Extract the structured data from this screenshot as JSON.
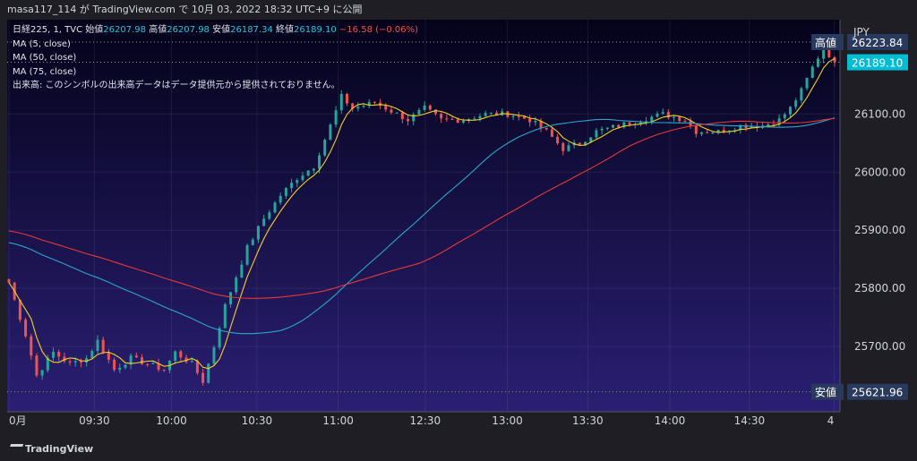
{
  "header": {
    "text": "masa117_114 が TradingView.com で 10月 03, 2022 18:32 UTC+9 に公開"
  },
  "legend": {
    "symbol": "日経225, 1, TVC",
    "open_label": "始値",
    "open": "26207.98",
    "high_label": "高値",
    "high": "26207.98",
    "low_label": "安値",
    "low": "26187.34",
    "close_label": "終値",
    "close": "26189.10",
    "change": "−16.58 (−0.06%)",
    "ma1": "MA (5, close)",
    "ma2": "MA (50, close)",
    "ma3": "MA (75, close)",
    "volume_note": "出来高: このシンボルの出来高データはデータ提供元から提供されておりません。"
  },
  "axis": {
    "currency": "JPY",
    "high_tag": "高値",
    "high_value": "26223.84",
    "last_value": "26189.10",
    "low_tag": "安値",
    "low_value": "25621.96"
  },
  "footer": {
    "brand": "TradingView"
  },
  "colors": {
    "bg_top": "#04031a",
    "bg_bottom": "#2a1f73",
    "up": "#26a69a",
    "down": "#ef5350",
    "ma5": "#f5d020",
    "ma50": "#2aa7c9",
    "ma75": "#e53935",
    "last_bg": "#00bcd4",
    "tag_bg": "#2a3a5e"
  },
  "chart_data": {
    "type": "candlestick",
    "ylim": [
      25600,
      26250
    ],
    "y_ticks": [
      "25700.00",
      "25800.00",
      "25900.00",
      "26000.00",
      "26100.00"
    ],
    "x_ticks": [
      "0月",
      "09:30",
      "10:00",
      "10:30",
      "11:00",
      "12:30",
      "13:00",
      "13:30",
      "14:00",
      "14:30",
      "4"
    ],
    "close_path": [
      [
        0,
        25810
      ],
      [
        3,
        25720
      ],
      [
        5,
        25650
      ],
      [
        8,
        25690
      ],
      [
        11,
        25670
      ],
      [
        14,
        25680
      ],
      [
        16,
        25710
      ],
      [
        19,
        25660
      ],
      [
        22,
        25680
      ],
      [
        25,
        25670
      ],
      [
        28,
        25660
      ],
      [
        30,
        25690
      ],
      [
        33,
        25670
      ],
      [
        35,
        25640
      ],
      [
        37,
        25700
      ],
      [
        39,
        25770
      ],
      [
        41,
        25820
      ],
      [
        43,
        25870
      ],
      [
        46,
        25920
      ],
      [
        49,
        25960
      ],
      [
        52,
        25990
      ],
      [
        55,
        26010
      ],
      [
        58,
        26080
      ],
      [
        60,
        26130
      ],
      [
        62,
        26110
      ],
      [
        66,
        26120
      ],
      [
        70,
        26100
      ],
      [
        72,
        26090
      ],
      [
        75,
        26110
      ],
      [
        78,
        26090
      ],
      [
        82,
        26090
      ],
      [
        86,
        26100
      ],
      [
        90,
        26100
      ],
      [
        94,
        26090
      ],
      [
        97,
        26070
      ],
      [
        100,
        26040
      ],
      [
        103,
        26050
      ],
      [
        106,
        26070
      ],
      [
        110,
        26080
      ],
      [
        114,
        26090
      ],
      [
        118,
        26100
      ],
      [
        122,
        26090
      ],
      [
        124,
        26070
      ],
      [
        128,
        26070
      ],
      [
        132,
        26080
      ],
      [
        136,
        26080
      ],
      [
        139,
        26090
      ],
      [
        141,
        26110
      ],
      [
        143,
        26140
      ],
      [
        145,
        26180
      ],
      [
        147,
        26215
      ],
      [
        149,
        26189
      ]
    ],
    "ma_lines": [
      {
        "period": 5
      },
      {
        "period": 50
      },
      {
        "period": 75
      }
    ]
  }
}
